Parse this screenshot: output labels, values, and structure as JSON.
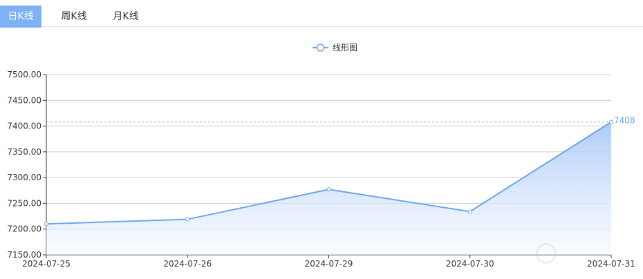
{
  "tabs": [
    {
      "label": "日K线",
      "active": true
    },
    {
      "label": "周K线",
      "active": false
    },
    {
      "label": "月K线",
      "active": false
    }
  ],
  "chart_data": {
    "type": "area",
    "legend": {
      "label": "线形图",
      "position": "top-center"
    },
    "x": [
      "2024-07-25",
      "2024-07-26",
      "2024-07-29",
      "2024-07-30",
      "2024-07-31"
    ],
    "series": [
      {
        "name": "线形图",
        "values": [
          7210,
          7219,
          7277,
          7234,
          7408
        ]
      }
    ],
    "ylim": [
      7150,
      7500
    ],
    "yticks": [
      "7500.00",
      "7450.00",
      "7400.00",
      "7350.00",
      "7300.00",
      "7250.00",
      "7200.00",
      "7150.00"
    ],
    "markline": {
      "value": 7408,
      "label": "7408"
    },
    "grid": true,
    "colors": {
      "line": "#6aa6ec",
      "fill_top": "#a9c9f8",
      "fill_bottom": "#f6f9ff",
      "markline": "#6aa6ec",
      "axis_text": "#333333",
      "grid": "#cccccc"
    }
  }
}
